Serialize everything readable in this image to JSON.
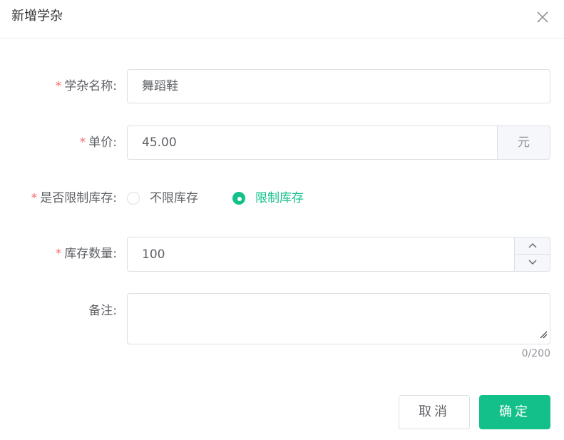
{
  "dialog": {
    "title": "新增学杂",
    "close_icon": "close-icon"
  },
  "form": {
    "required_mark": "*",
    "name": {
      "label": "学杂名称:",
      "value": "舞蹈鞋"
    },
    "price": {
      "label": "单价:",
      "value": "45.00",
      "unit": "元"
    },
    "limit_stock": {
      "label": "是否限制库存:",
      "options": [
        {
          "label": "不限库存",
          "checked": false
        },
        {
          "label": "限制库存",
          "checked": true
        }
      ]
    },
    "stock_qty": {
      "label": "库存数量:",
      "value": "100",
      "up_icon": "chevron-up-icon",
      "down_icon": "chevron-down-icon"
    },
    "remark": {
      "label": "备注:",
      "value": "",
      "count": "0/200"
    }
  },
  "footer": {
    "cancel_label": "取消",
    "ok_label": "确定"
  },
  "colors": {
    "primary": "#13c08a",
    "required": "#f56c6c",
    "border": "#dcdfe6"
  }
}
